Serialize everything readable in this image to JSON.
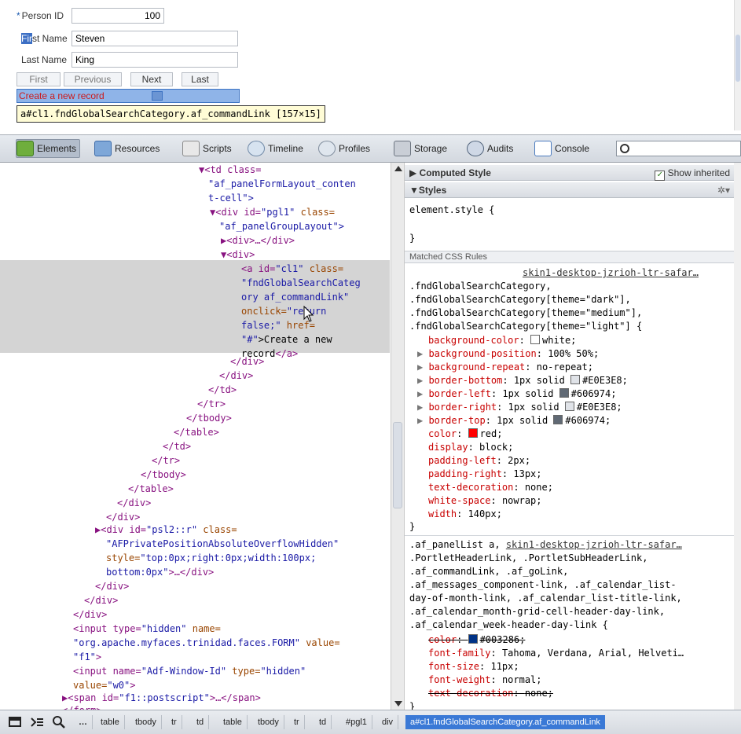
{
  "form": {
    "person_id_required": "*",
    "person_id_label": "Person ID",
    "person_id_value": "100",
    "first_name_label_hl": "Fir",
    "first_name_label_rest": "st Name",
    "first_name_value": "Steven",
    "last_name_label": "Last Name",
    "last_name_value": "King",
    "buttons": {
      "first": "First",
      "previous": "Previous",
      "next": "Next",
      "last": "Last"
    },
    "create_link": "Create a new record",
    "hover_tooltip": "a#cl1.fndGlobalSearchCategory.af_commandLink [157×15]"
  },
  "toolbar": {
    "elements": "Elements",
    "resources": "Resources",
    "scripts": "Scripts",
    "timeline": "Timeline",
    "profiles": "Profiles",
    "storage": "Storage",
    "audits": "Audits",
    "console": "Console",
    "search_placeholder": ""
  },
  "dom": {
    "l1": "td class=",
    "l1v": "\"af_panelFormLayout_conten",
    "l2v": "t-cell\">",
    "l3a": "div id=",
    "l3b": "\"pgl1\"",
    "l3c": " class=",
    "l4v": "\"af_panelGroupLayout\">",
    "l5": "<div>…</div>",
    "l6": "<div>",
    "l7a": "<a id=",
    "l7b": "\"cl1\"",
    "l7c": " class=",
    "l8": "\"fndGlobalSearchCateg",
    "l9": "ory af_commandLink\"",
    "l10a": "onclick=",
    "l10b": "\"return",
    "l11a": "false;\"",
    "l11b": " href=",
    "l12a": "\"#\"",
    "l12b": ">Create a new",
    "l13a": "record",
    "l13b": "</a>",
    "c1": "</div>",
    "c2": "</div>",
    "c3": "</td>",
    "c4": "</tr>",
    "c5": "</tbody>",
    "c6": "</table>",
    "c7": "</td>",
    "c8": "</tr>",
    "c9": "</tbody>",
    "c10": "</table>",
    "c11": "</div>",
    "c12": "</div>",
    "psl_a": "<div id=",
    "psl_b": "\"psl2::r\"",
    "psl_c": " class=",
    "psl_d": "\"AFPrivatePositionAbsoluteOverflowHidden\"",
    "psl_e": "style=",
    "psl_f": "\"top:0px;right:0px;width:100px;",
    "psl_g": "bottom:0px\"",
    "psl_h": ">…</div>",
    "c13": "</div>",
    "c14": "</div>",
    "c15": "</div>",
    "in1a": "<input type=",
    "in1b": "\"hidden\"",
    "in1c": " name=",
    "in1d": "\"org.apache.myfaces.trinidad.faces.FORM\"",
    "in1e": " value=",
    "in1f": "\"f1\"",
    "in1g": ">",
    "in2a": "<input name=",
    "in2b": "\"Adf-Window-Id\"",
    "in2c": " type=",
    "in2d": "\"hidden\"",
    "in2e": "value=",
    "in2f": "\"w0\"",
    "in2g": ">",
    "span_a": "<span id=",
    "span_b": "\"f1::postscript\"",
    "span_c": ">…</span>",
    "form_close": "</form>"
  },
  "styles": {
    "computed_header": "Computed Style",
    "show_inherited": "Show inherited",
    "styles_header": "Styles",
    "element_style": "element.style {",
    "close_brace": "}",
    "matched_rules": "Matched CSS Rules",
    "source1": "skin1-desktop-jzrioh-ltr-safar…",
    "sel1": ".fndGlobalSearchCategory,",
    "sel2": ".fndGlobalSearchCategory[theme=\"dark\"],",
    "sel3": ".fndGlobalSearchCategory[theme=\"medium\"],",
    "sel4": ".fndGlobalSearchCategory[theme=\"light\"] {",
    "rule1": [
      {
        "p": "background-color",
        "v": "white;",
        "swatch": "#ffffff",
        "exp": false
      },
      {
        "p": "background-position",
        "v": "100% 50%;",
        "exp": true
      },
      {
        "p": "background-repeat",
        "v": "no-repeat;",
        "exp": true
      },
      {
        "p": "border-bottom",
        "v": "1px solid ",
        "swatch": "#E0E3E8",
        "v2": "#E0E3E8;",
        "exp": true
      },
      {
        "p": "border-left",
        "v": "1px solid ",
        "swatch": "#606974",
        "v2": "#606974;",
        "exp": true
      },
      {
        "p": "border-right",
        "v": "1px solid ",
        "swatch": "#E0E3E8",
        "v2": "#E0E3E8;",
        "exp": true
      },
      {
        "p": "border-top",
        "v": "1px solid ",
        "swatch": "#606974",
        "v2": "#606974;",
        "exp": true
      },
      {
        "p": "color",
        "v": "red;",
        "swatch": "#ff0000",
        "exp": false
      },
      {
        "p": "display",
        "v": "block;",
        "exp": false
      },
      {
        "p": "padding-left",
        "v": "2px;",
        "exp": false
      },
      {
        "p": "padding-right",
        "v": "13px;",
        "exp": false
      },
      {
        "p": "text-decoration",
        "v": "none;",
        "exp": false
      },
      {
        "p": "white-space",
        "v": "nowrap;",
        "exp": false
      },
      {
        "p": "width",
        "v": "140px;",
        "exp": false
      }
    ],
    "sel5": ".af_panelList a, ",
    "source2": "skin1-desktop-jzrioh-ltr-safar…",
    "sel6": ".PortletHeaderLink, .PortletSubHeaderLink,",
    "sel7": ".af_commandLink, .af_goLink,",
    "sel8": ".af_messages_component-link, .af_calendar_list-",
    "sel9": "day-of-month-link, .af_calendar_list-title-link,",
    "sel10": ".af_calendar_month-grid-cell-header-day-link,",
    "sel11": ".af_calendar_week-header-day-link {",
    "r2_color_p": "color",
    "r2_color_v": "#003286;",
    "r2_ff_p": "font-family",
    "r2_ff_v": "Tahoma, Verdana, Arial, Helveti…",
    "r2_fs_p": "font-size",
    "r2_fs_v": "11px;",
    "r2_fw_p": "font-weight",
    "r2_fw_v": "normal;",
    "r2_td_p": "text-decoration",
    "r2_td_v": "none;",
    "r2_close": "}"
  },
  "breadcrumbs": [
    "table",
    "tbody",
    "tr",
    "td",
    "table",
    "tbody",
    "tr",
    "td",
    "#pgl1",
    "div",
    "a#cl1.fndGlobalSearchCategory.af_commandLink"
  ],
  "statusbar": {
    "more": "…"
  }
}
